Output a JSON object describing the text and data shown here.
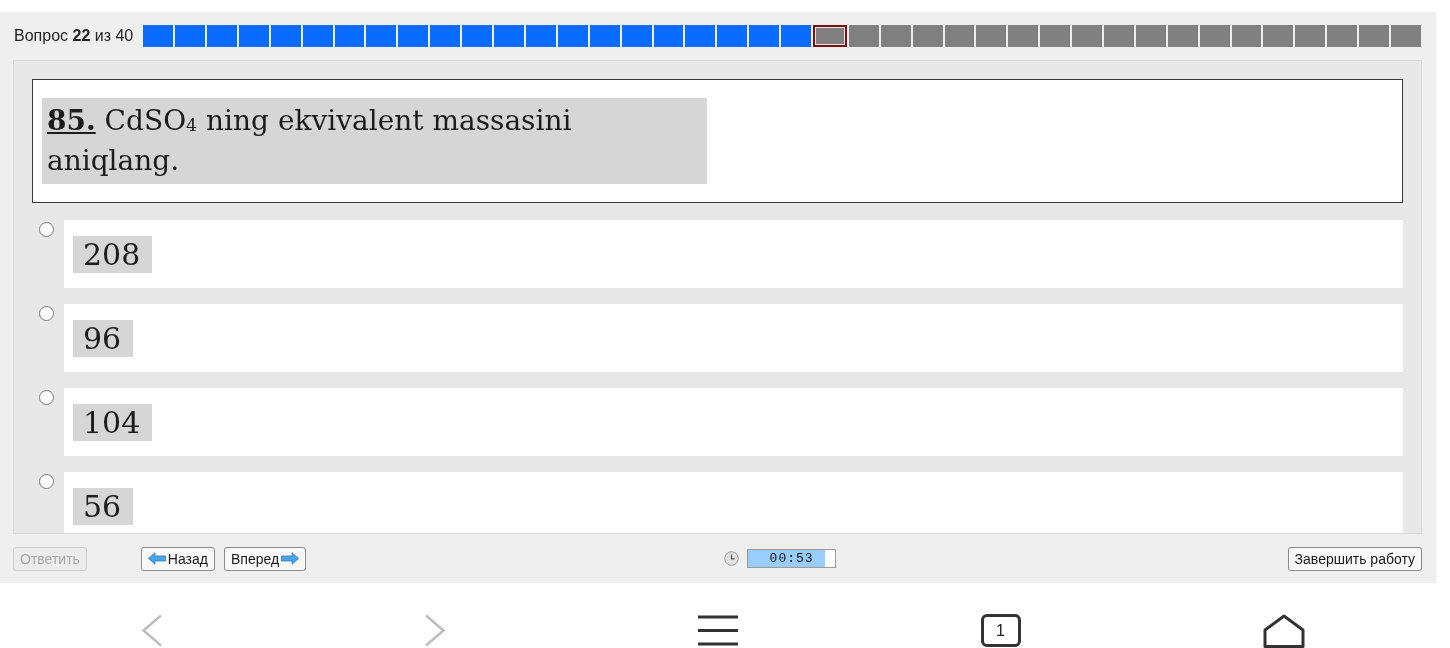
{
  "header": {
    "label": "Вопрос **22** из 40"
  },
  "progress": [
    {
      "answered": true,
      "selected": false
    },
    {
      "answered": true,
      "selected": false
    },
    {
      "answered": true,
      "selected": false
    },
    {
      "answered": true,
      "selected": false
    },
    {
      "answered": true,
      "selected": false
    },
    {
      "answered": true,
      "selected": false
    },
    {
      "answered": true,
      "selected": false
    },
    {
      "answered": true,
      "selected": false
    },
    {
      "answered": true,
      "selected": false
    },
    {
      "answered": true,
      "selected": false
    },
    {
      "answered": true,
      "selected": false
    },
    {
      "answered": true,
      "selected": false
    },
    {
      "answered": true,
      "selected": false
    },
    {
      "answered": true,
      "selected": false
    },
    {
      "answered": true,
      "selected": false
    },
    {
      "answered": true,
      "selected": false
    },
    {
      "answered": true,
      "selected": false
    },
    {
      "answered": true,
      "selected": false
    },
    {
      "answered": true,
      "selected": false
    },
    {
      "answered": true,
      "selected": false
    },
    {
      "answered": true,
      "selected": false
    },
    {
      "answered": false,
      "selected": true
    },
    {
      "answered": false,
      "selected": false
    },
    {
      "answered": false,
      "selected": false
    },
    {
      "answered": false,
      "selected": false
    },
    {
      "answered": false,
      "selected": false
    },
    {
      "answered": false,
      "selected": false
    },
    {
      "answered": false,
      "selected": false
    },
    {
      "answered": false,
      "selected": false
    },
    {
      "answered": false,
      "selected": false
    },
    {
      "answered": false,
      "selected": false
    },
    {
      "answered": false,
      "selected": false
    },
    {
      "answered": false,
      "selected": false
    },
    {
      "answered": false,
      "selected": false
    },
    {
      "answered": false,
      "selected": false
    },
    {
      "answered": false,
      "selected": false
    },
    {
      "answered": false,
      "selected": false
    },
    {
      "answered": false,
      "selected": false
    },
    {
      "answered": false,
      "selected": false
    },
    {
      "answered": false,
      "selected": false
    }
  ],
  "question": {
    "text": "**85.** CdSO$_{4}$ ning ekvivalent massasini aniqlang."
  },
  "options": [
    {
      "text": "208",
      "selected": false
    },
    {
      "text": "96",
      "selected": false
    },
    {
      "text": "104",
      "selected": false
    },
    {
      "text": "56",
      "selected": false
    }
  ],
  "toolbar": {
    "answer_button": {
      "label": "Ответить",
      "disabled": true
    },
    "back_button": {
      "label": "Назад"
    },
    "forward_button": {
      "label": "Вперед"
    },
    "timer": {
      "value": "00:53",
      "level": 0.88
    },
    "finish_button": {
      "label": "Завершить работу"
    }
  },
  "nav_bar": {
    "back": {
      "disabled": true
    },
    "forward": {
      "disabled": true
    },
    "tabs_count": "1"
  }
}
